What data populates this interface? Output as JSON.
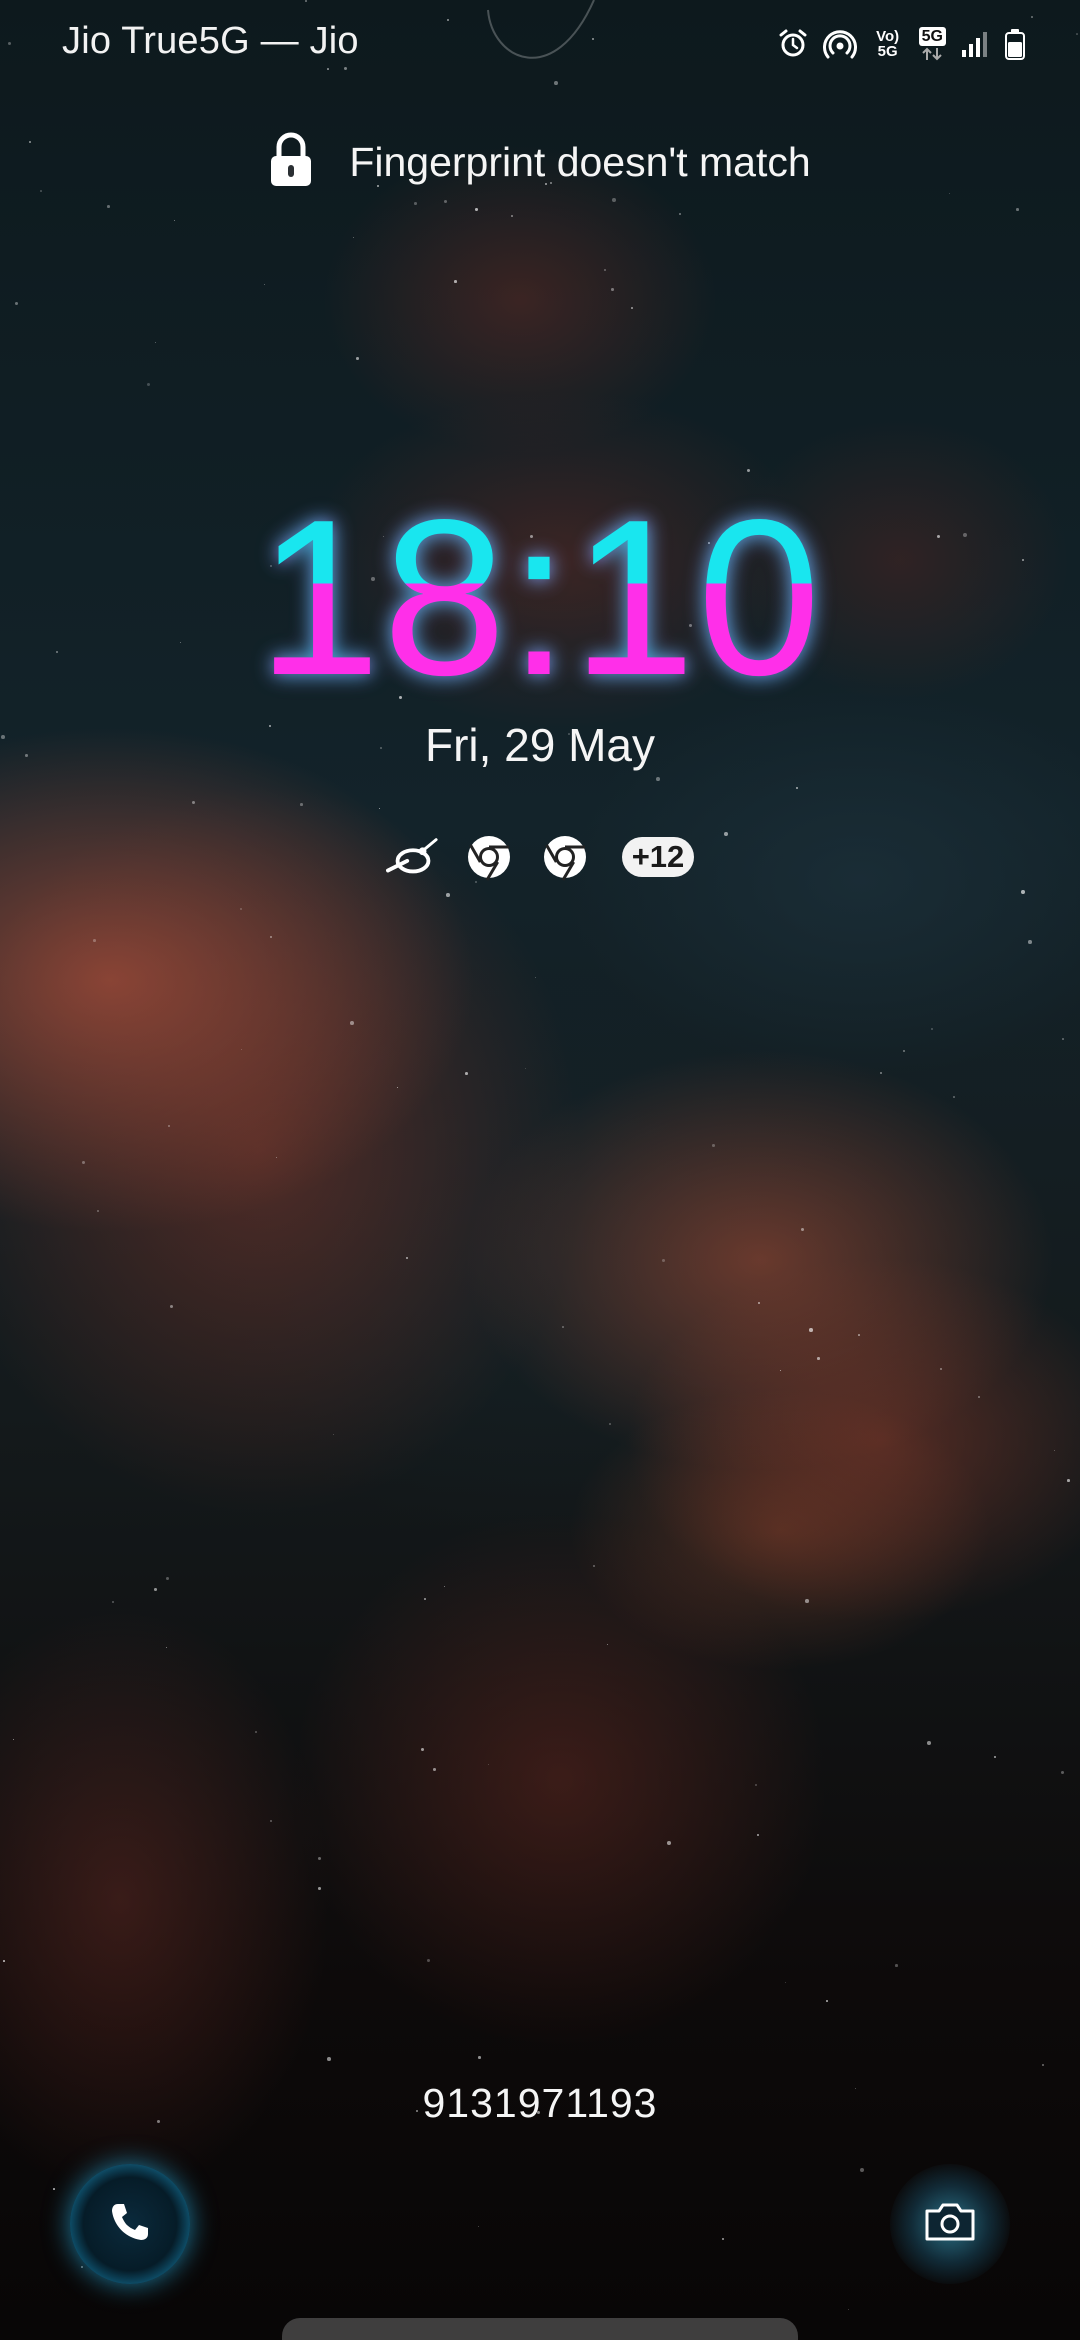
{
  "status_bar": {
    "carrier": "Jio True5G — Jio",
    "volte_label": "Vo) 5G",
    "network_badge": "5G",
    "icons": [
      "alarm-icon",
      "hotspot-icon",
      "volte-icon",
      "5g-data-icon",
      "signal-icon",
      "battery-icon"
    ]
  },
  "lock": {
    "message": "Fingerprint doesn't match",
    "icon": "lock-icon"
  },
  "clock": {
    "time": "18:10",
    "date": "Fri, 29 May",
    "colors": {
      "top": "#19e6ef",
      "bottom": "#ff2fe9"
    }
  },
  "notifications": {
    "icons": [
      "bird-app-icon",
      "chrome-icon",
      "chrome-icon"
    ],
    "more_count": "+12"
  },
  "owner_info": "9131971193",
  "shortcuts": {
    "left": "phone-icon",
    "right": "camera-icon"
  }
}
